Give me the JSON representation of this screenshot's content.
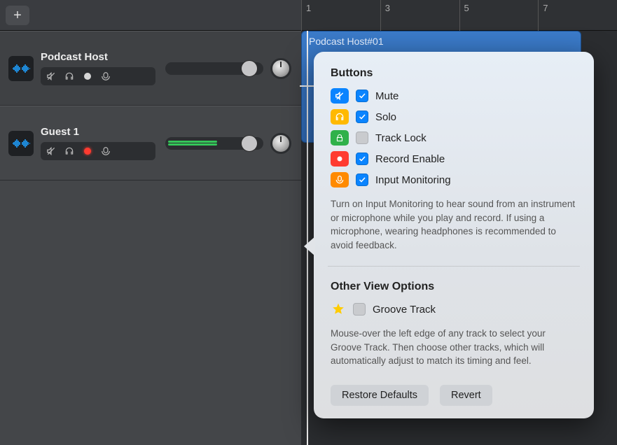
{
  "ruler": {
    "marks": [
      "1",
      "3",
      "5",
      "7"
    ]
  },
  "tracks": [
    {
      "name": "Podcast Host",
      "recording": false,
      "volume_thumb_pct": 78,
      "meter_active": false
    },
    {
      "name": "Guest 1",
      "recording": true,
      "volume_thumb_pct": 78,
      "meter_active": true
    }
  ],
  "region": {
    "title": "Podcast Host#01"
  },
  "popover": {
    "section_buttons_title": "Buttons",
    "options": [
      {
        "icon": "mute",
        "label": "Mute",
        "checked": true
      },
      {
        "icon": "solo",
        "label": "Solo",
        "checked": true
      },
      {
        "icon": "lock",
        "label": "Track Lock",
        "checked": false
      },
      {
        "icon": "rec",
        "label": "Record Enable",
        "checked": true
      },
      {
        "icon": "mon",
        "label": "Input Monitoring",
        "checked": true
      }
    ],
    "buttons_tip": "Turn on Input Monitoring to hear sound from an instrument or microphone while you play and record. If using a microphone, wearing headphones is recommended to avoid feedback.",
    "section_other_title": "Other View Options",
    "groove": {
      "label": "Groove Track",
      "checked": false
    },
    "other_tip": "Mouse-over the left edge of any track to select your Groove Track. Then choose other tracks, which will automatically adjust to match its timing and feel.",
    "restore_label": "Restore Defaults",
    "revert_label": "Revert"
  }
}
